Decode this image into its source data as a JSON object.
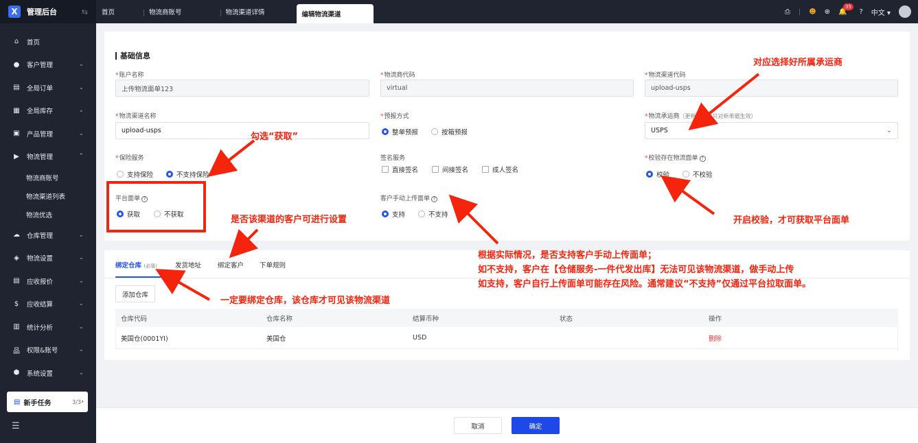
{
  "app": {
    "title": "管理后台",
    "logo_letter": "X"
  },
  "sidebar": {
    "items": [
      {
        "label": "首页",
        "icon": "home-icon",
        "glyph": "⌂"
      },
      {
        "label": "客户管理",
        "icon": "users-icon",
        "glyph": "👥"
      },
      {
        "label": "全局订单",
        "icon": "clipboard-icon",
        "glyph": "▤"
      },
      {
        "label": "全局库存",
        "icon": "warehouse-icon",
        "glyph": "▦"
      },
      {
        "label": "产品管理",
        "icon": "box-icon",
        "glyph": "▣"
      },
      {
        "label": "物流管理",
        "icon": "truck-icon",
        "glyph": "⛟"
      }
    ],
    "sub_items": [
      "物流商账号",
      "物流渠道列表",
      "物流优选"
    ],
    "items2": [
      {
        "label": "仓库管理",
        "icon": "warehouse-cloud-icon",
        "glyph": "☁"
      },
      {
        "label": "物流设置",
        "icon": "package-icon",
        "glyph": "◈"
      },
      {
        "label": "应收报价",
        "icon": "document-icon",
        "glyph": "▤"
      },
      {
        "label": "应收结算",
        "icon": "money-icon",
        "glyph": "$"
      },
      {
        "label": "统计分析",
        "icon": "chart-icon",
        "glyph": "▥"
      },
      {
        "label": "权限&账号",
        "icon": "org-icon",
        "glyph": "品"
      },
      {
        "label": "系统设置",
        "icon": "settings-icon",
        "glyph": "⬢"
      }
    ],
    "task": {
      "label": "新手任务",
      "count": "3/3"
    }
  },
  "tabs": [
    "首页",
    "物流商账号",
    "物流渠道详情",
    "编辑物流渠道"
  ],
  "header": {
    "lang": "中文",
    "notif_count": "35"
  },
  "form": {
    "section_title": "基础信息",
    "account_name": {
      "label": "账户名称",
      "value": "上传物流面单123"
    },
    "carrier_code": {
      "label": "物流商代码",
      "value": "virtual"
    },
    "channel_code": {
      "label": "物流渠道代码",
      "value": "upload-usps"
    },
    "channel_name": {
      "label": "物流渠道名称",
      "value": "upload-usps"
    },
    "prereport": {
      "label": "预报方式",
      "opt1": "整单预报",
      "opt2": "按箱预报"
    },
    "carrier": {
      "label": "物流承运商",
      "hint": "（更新承运商只对新单据生效）",
      "value": "USPS"
    },
    "insurance": {
      "label": "保险服务",
      "opt1": "支持保险",
      "opt2": "不支持保险"
    },
    "signature": {
      "label": "签名服务",
      "opt1": "直接签名",
      "opt2": "间接签名",
      "opt3": "成人签名"
    },
    "verify": {
      "label": "校验存在物流面单",
      "opt1": "校验",
      "opt2": "不校验"
    },
    "platform_label": {
      "label": "平台面单",
      "opt1": "获取",
      "opt2": "不获取"
    },
    "manual_upload": {
      "label": "客户手动上传面单",
      "opt1": "支持",
      "opt2": "不支持"
    }
  },
  "lower": {
    "tabs": {
      "t1": "绑定仓库",
      "t1_sub": "(必填)",
      "t2": "发货地址",
      "t3": "绑定客户",
      "t4": "下单规则"
    },
    "add_button": "添加仓库",
    "columns": [
      "仓库代码",
      "仓库名称",
      "结算币种",
      "状态",
      "操作"
    ],
    "row": {
      "code": "美国仓(0001YI)",
      "name": "美国仓",
      "currency": "USD",
      "status": "",
      "action": "删除"
    }
  },
  "footer": {
    "cancel": "取消",
    "confirm": "确定"
  },
  "annotations": {
    "a1": "对应选择好所属承运商",
    "a2": "勾选“获取”",
    "a3": "是否该渠道的客户可进行设置",
    "a4": "开启校验，才可获取平台面单",
    "a5_1": "根据实际情况，是否支持客户手动上传面单；",
    "a5_2": "如不支持，客户在【仓储服务-一件代发出库】无法可见该物流渠道，做手动上传",
    "a5_3": "如支持，客户自行上传面单可能存在风险。通常建议“不支持”仅通过平台拉取面单。",
    "a6": "一定要绑定仓库，该仓库才可见该物流渠道"
  },
  "colors": {
    "sidebar": "#1f2430",
    "primary": "#1d49e8",
    "annotation": "#f5240d",
    "danger": "#f5313b"
  }
}
